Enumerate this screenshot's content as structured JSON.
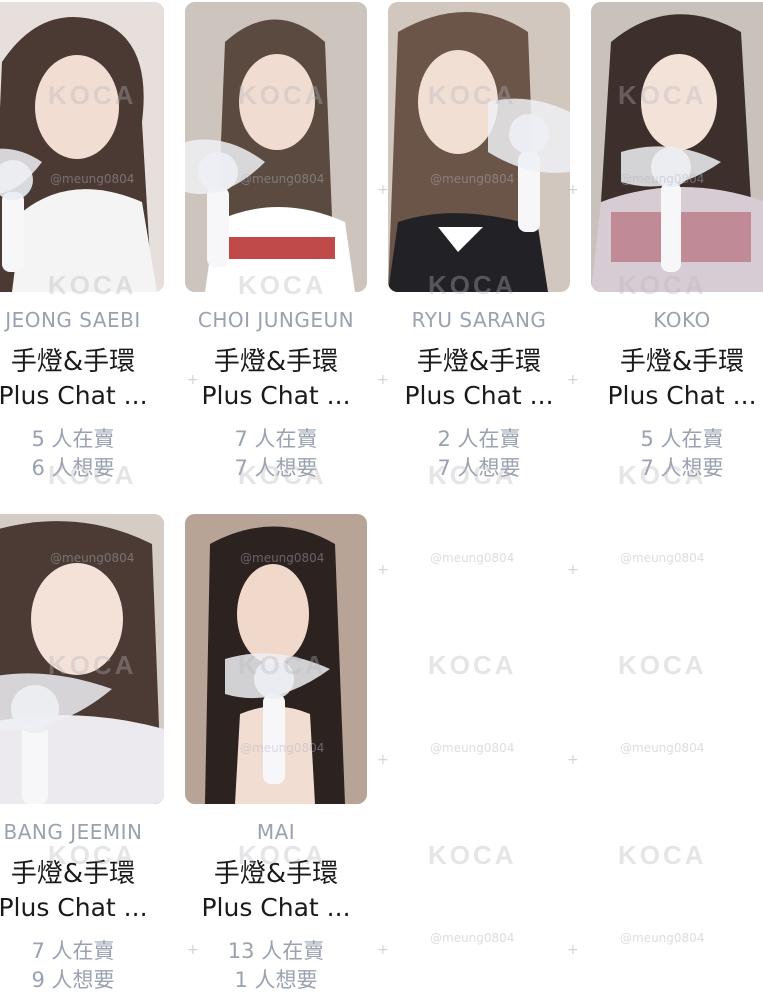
{
  "watermark": {
    "logo": "KOCA",
    "handle": "@meung0804"
  },
  "cards": [
    {
      "name": "JEONG SAEBI",
      "item": "手燈&手環",
      "desc": "Plus Chat ...",
      "selling": "5 人在賣",
      "wanting": "6 人想要"
    },
    {
      "name": "CHOI JUNGEUN",
      "item": "手燈&手環",
      "desc": "Plus Chat ...",
      "selling": "7 人在賣",
      "wanting": "7 人想要"
    },
    {
      "name": "RYU SARANG",
      "item": "手燈&手環",
      "desc": "Plus Chat ...",
      "selling": "2 人在賣",
      "wanting": "7 人想要"
    },
    {
      "name": "KOKO",
      "item": "手燈&手環",
      "desc": "Plus Chat ...",
      "selling": "5 人在賣",
      "wanting": "7 人想要"
    },
    {
      "name": "BANG JEEMIN",
      "item": "手燈&手環",
      "desc": "Plus Chat ...",
      "selling": "7 人在賣",
      "wanting": "9 人想要"
    },
    {
      "name": "MAI",
      "item": "手燈&手環",
      "desc": "Plus Chat ...",
      "selling": "13 人在賣",
      "wanting": "1 人想要"
    }
  ],
  "colors": {
    "muted_text": "#9aa2b0",
    "main_text": "#1a1a1a",
    "background": "#ffffff"
  }
}
